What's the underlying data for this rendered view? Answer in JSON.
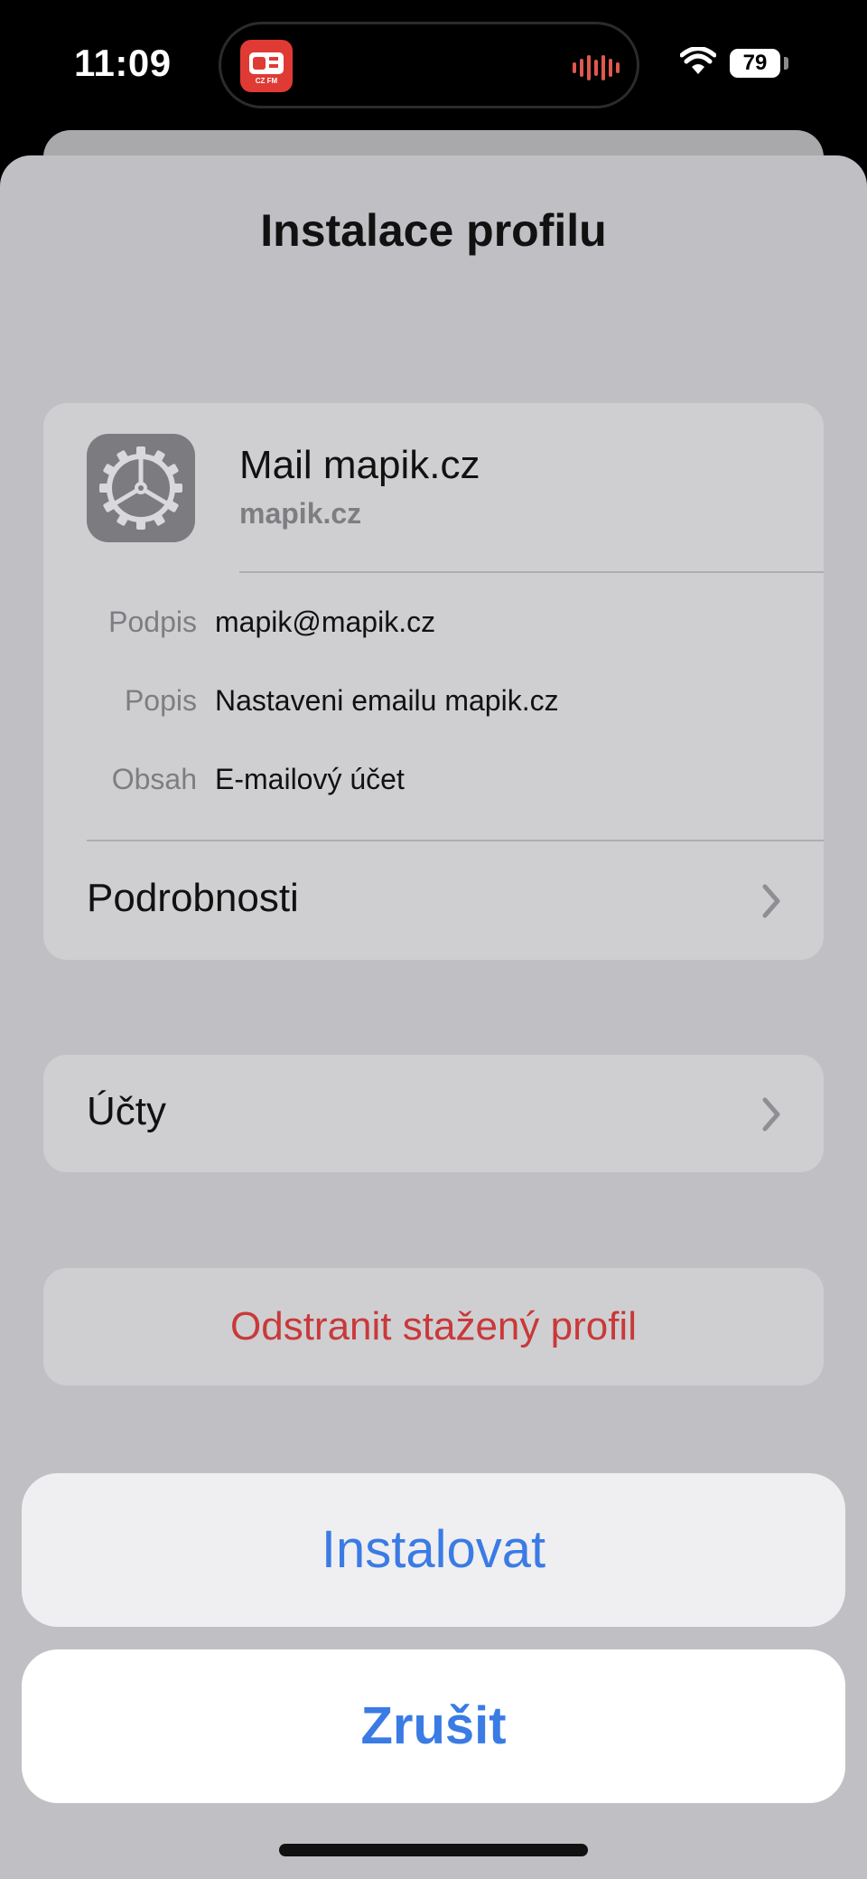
{
  "status_bar": {
    "time": "11:09",
    "live_activity_app_label": "CZ FM",
    "battery_level": "79",
    "wifi_icon": "wifi-icon",
    "audio_icon": "audio-waveform-icon",
    "accent_color": "#e03a35"
  },
  "sheet": {
    "title": "Instalace profilu"
  },
  "profile": {
    "icon": "gear-icon",
    "name": "Mail mapik.cz",
    "domain": "mapik.cz",
    "rows": [
      {
        "label": "Podpis",
        "value": "mapik@mapik.cz"
      },
      {
        "label": "Popis",
        "value": "Nastaveni emailu mapik.cz"
      },
      {
        "label": "Obsah",
        "value": "E-mailový účet"
      }
    ],
    "details_label": "Podrobnosti"
  },
  "accounts": {
    "label": "Účty"
  },
  "remove": {
    "label": "Odstranit stažený profil",
    "color": "#c9393a"
  },
  "actions": {
    "install_label": "Instalovat",
    "cancel_label": "Zrušit",
    "link_color": "#3a7be4"
  }
}
